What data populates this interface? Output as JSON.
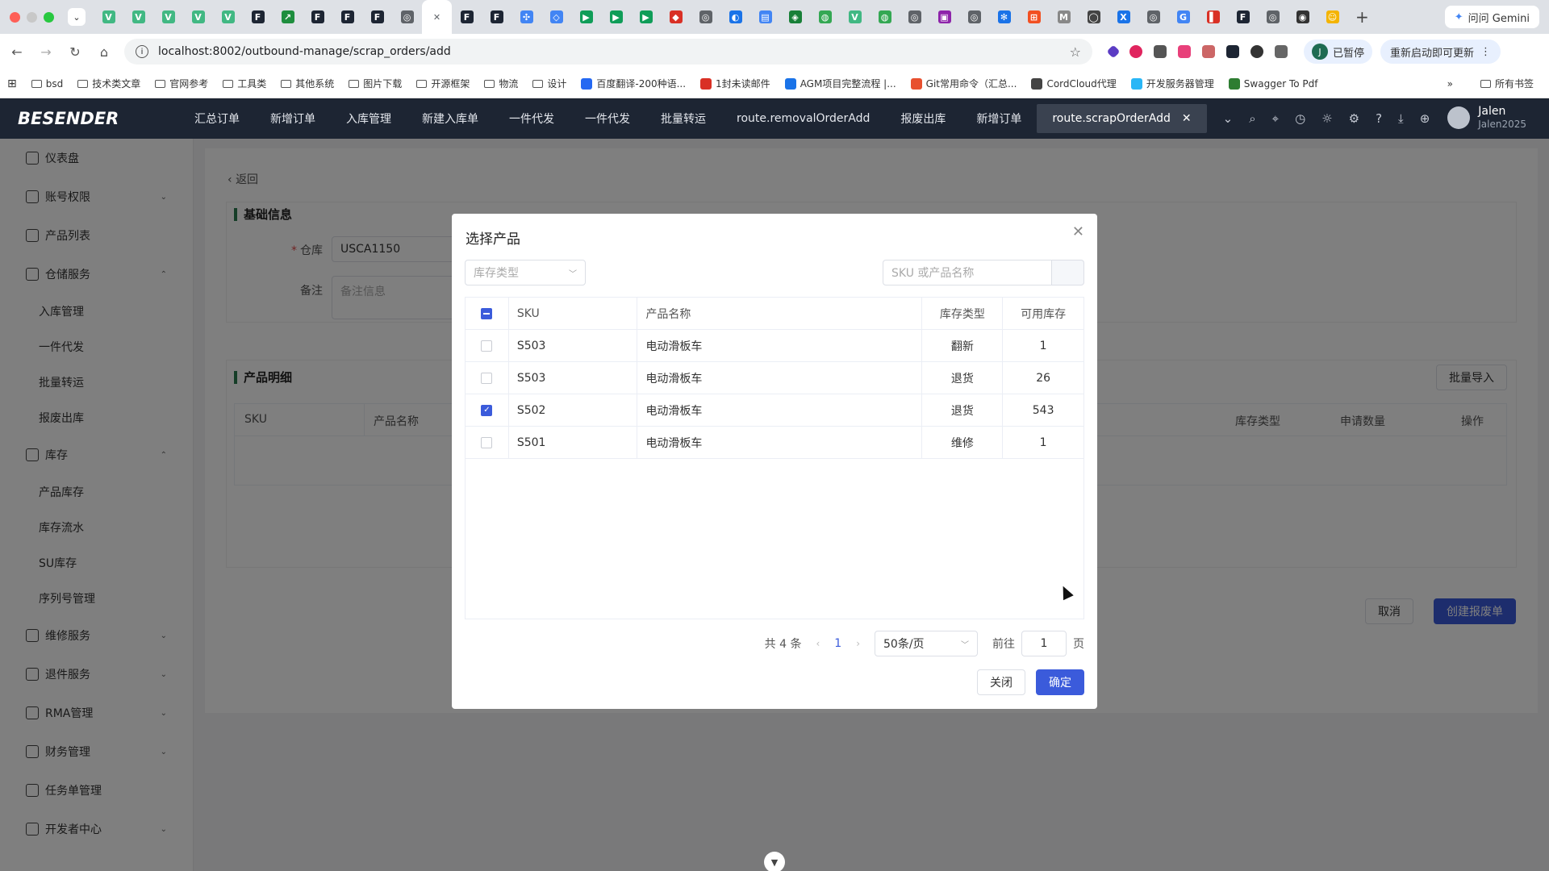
{
  "browser": {
    "gemini_label": "问问 Gemini",
    "url": "localhost:8002/outbound-manage/scrap_orders/add",
    "profile_initial": "J",
    "profile_status": "已暂停",
    "restart_label": "重新启动即可更新",
    "tab_icons": [
      {
        "name": "vue-tab-icon",
        "glyph": "V",
        "color": "#41b883"
      },
      {
        "name": "vue-tab-icon",
        "glyph": "V",
        "color": "#41b883"
      },
      {
        "name": "vue-tab-icon",
        "glyph": "V",
        "color": "#41b883"
      },
      {
        "name": "vue-tab-icon",
        "glyph": "V",
        "color": "#41b883"
      },
      {
        "name": "vue-tab-icon",
        "glyph": "V",
        "color": "#41b883"
      },
      {
        "name": "besender-tab-icon",
        "glyph": "F",
        "color": "#1d2533"
      },
      {
        "name": "chart-tab-icon",
        "glyph": "↗",
        "color": "#1e8e3e"
      },
      {
        "name": "besender-tab-icon",
        "glyph": "F",
        "color": "#1d2533"
      },
      {
        "name": "besender-tab-icon",
        "glyph": "F",
        "color": "#1d2533"
      },
      {
        "name": "besender-tab-icon",
        "glyph": "F",
        "color": "#1d2533"
      },
      {
        "name": "globe-tab-icon",
        "glyph": "◎",
        "color": "#5f6368"
      },
      {
        "name": "close-tab-icon",
        "glyph": "✕",
        "color": "#5f6368"
      },
      {
        "name": "besender-tab-icon",
        "glyph": "F",
        "color": "#1d2533"
      },
      {
        "name": "besender-tab-icon",
        "glyph": "F",
        "color": "#1d2533"
      },
      {
        "name": "network-tab-icon",
        "glyph": "✣",
        "color": "#4285f4"
      },
      {
        "name": "cube-tab-icon",
        "glyph": "◇",
        "color": "#4285f4"
      },
      {
        "name": "play-tab-icon",
        "glyph": "▶",
        "color": "#0f9d58"
      },
      {
        "name": "play-tab-icon",
        "glyph": "▶",
        "color": "#0f9d58"
      },
      {
        "name": "play-tab-icon",
        "glyph": "▶",
        "color": "#0f9d58"
      },
      {
        "name": "red-tab-icon",
        "glyph": "◆",
        "color": "#d93025"
      },
      {
        "name": "globe-tab-icon",
        "glyph": "◎",
        "color": "#5f6368"
      },
      {
        "name": "edge-tab-icon",
        "glyph": "◐",
        "color": "#1a73e8"
      },
      {
        "name": "doc-tab-icon",
        "glyph": "▤",
        "color": "#4285f4"
      },
      {
        "name": "shield-tab-icon",
        "glyph": "◈",
        "color": "#188038"
      },
      {
        "name": "leaf-tab-icon",
        "glyph": "◍",
        "color": "#34a853"
      },
      {
        "name": "vue-tab-icon",
        "glyph": "V",
        "color": "#41b883"
      },
      {
        "name": "leaf-tab-icon",
        "glyph": "◍",
        "color": "#34a853"
      },
      {
        "name": "globe-tab-icon",
        "glyph": "◎",
        "color": "#5f6368"
      },
      {
        "name": "purple-tab-icon",
        "glyph": "▣",
        "color": "#8e24aa"
      },
      {
        "name": "globe-tab-icon",
        "glyph": "◎",
        "color": "#5f6368"
      },
      {
        "name": "gear-tab-icon",
        "glyph": "✻",
        "color": "#1a73e8"
      },
      {
        "name": "microsoft-tab-icon",
        "glyph": "⊞",
        "color": "#f25022"
      },
      {
        "name": "mail-tab-icon",
        "glyph": "M",
        "color": "#888888"
      },
      {
        "name": "node-tab-icon",
        "glyph": "◯",
        "color": "#444444"
      },
      {
        "name": "x-tab-icon",
        "glyph": "X",
        "color": "#1a73e8"
      },
      {
        "name": "globe-tab-icon",
        "glyph": "◎",
        "color": "#5f6368"
      },
      {
        "name": "google-tab-icon",
        "glyph": "G",
        "color": "#4285f4"
      },
      {
        "name": "bookmark-tab-icon",
        "glyph": "▌",
        "color": "#d93025"
      },
      {
        "name": "besender-tab-icon",
        "glyph": "F",
        "color": "#1d2533"
      },
      {
        "name": "globe-tab-icon",
        "glyph": "◎",
        "color": "#5f6368"
      },
      {
        "name": "github-tab-icon",
        "glyph": "◉",
        "color": "#333333"
      },
      {
        "name": "emoji-tab-icon",
        "glyph": "☺",
        "color": "#f4b400"
      }
    ],
    "bookmarks": [
      {
        "label": "bsd",
        "icon": "folder-icon"
      },
      {
        "label": "技术类文章",
        "icon": "folder-icon"
      },
      {
        "label": "官网参考",
        "icon": "folder-icon"
      },
      {
        "label": "工具类",
        "icon": "folder-icon"
      },
      {
        "label": "其他系统",
        "icon": "folder-icon"
      },
      {
        "label": "图片下载",
        "icon": "folder-icon"
      },
      {
        "label": "开源框架",
        "icon": "folder-icon"
      },
      {
        "label": "物流",
        "icon": "folder-icon"
      },
      {
        "label": "设计",
        "icon": "folder-icon"
      },
      {
        "label": "百度翻译-200种语...",
        "icon": "translate-icon",
        "color": "#2468f2"
      },
      {
        "label": "1封未读邮件",
        "icon": "gmail-icon",
        "color": "#d93025"
      },
      {
        "label": "AGM项目完整流程 |...",
        "icon": "onenote-icon",
        "color": "#1a73e8"
      },
      {
        "label": "Git常用命令（汇总...",
        "icon": "csdn-icon",
        "color": "#e8502f"
      },
      {
        "label": "CordCloud代理",
        "icon": "cord-icon",
        "color": "#444444"
      },
      {
        "label": "开发服务器管理",
        "icon": "server-icon",
        "color": "#29b6f6"
      },
      {
        "label": "Swagger To Pdf",
        "icon": "swagger-icon",
        "color": "#2e7d32"
      }
    ],
    "all_bookmarks_label": "所有书签"
  },
  "app": {
    "logo": "BESENDER",
    "nav_tabs": [
      "汇总订单",
      "新增订单",
      "入库管理",
      "新建入库单",
      "一件代发",
      "一件代发",
      "批量转运",
      "route.removalOrderAdd",
      "报废出库",
      "新增订单"
    ],
    "active_tab": "route.scrapOrderAdd",
    "user_name": "Jalen",
    "user_account": "Jalen2025"
  },
  "sidebar": {
    "items": [
      {
        "label": "仪表盘",
        "icon": "home-icon",
        "arrow": ""
      },
      {
        "label": "账号权限",
        "icon": "user-key-icon",
        "arrow": "⌄"
      },
      {
        "label": "产品列表",
        "icon": "list-icon",
        "arrow": ""
      },
      {
        "label": "仓储服务",
        "icon": "warehouse-icon",
        "arrow": "⌃"
      },
      {
        "label": "库存",
        "icon": "inventory-icon",
        "arrow": "⌃"
      },
      {
        "label": "维修服务",
        "icon": "wrench-icon",
        "arrow": "⌄"
      },
      {
        "label": "退件服务",
        "icon": "return-icon",
        "arrow": "⌄"
      },
      {
        "label": "RMA管理",
        "icon": "lock-icon",
        "arrow": "⌄"
      },
      {
        "label": "财务管理",
        "icon": "cart-icon",
        "arrow": "⌄"
      },
      {
        "label": "任务单管理",
        "icon": "task-icon",
        "arrow": ""
      },
      {
        "label": "开发者中心",
        "icon": "api-icon",
        "arrow": "⌄"
      }
    ],
    "warehouse_sub": [
      "入库管理",
      "一件代发",
      "批量转运",
      "报废出库"
    ],
    "inventory_sub": [
      "产品库存",
      "库存流水",
      "SU库存",
      "序列号管理"
    ]
  },
  "page": {
    "back_label": "返回",
    "basic_info_title": "基础信息",
    "warehouse_label": "仓库",
    "warehouse_value": "USCA1150",
    "remark_label": "备注",
    "remark_placeholder": "备注信息",
    "detail_title": "产品明细",
    "batch_import_label": "批量导入",
    "detail_columns": [
      "SKU",
      "产品名称",
      "库存类型",
      "申请数量",
      "操作"
    ],
    "cancel_label": "取消",
    "create_label": "创建报废单"
  },
  "dialog": {
    "title": "选择产品",
    "stock_type_placeholder": "库存类型",
    "search_placeholder": "SKU 或产品名称",
    "columns": [
      "SKU",
      "产品名称",
      "库存类型",
      "可用库存"
    ],
    "rows": [
      {
        "sku": "S503",
        "name": "电动滑板车",
        "type": "翻新",
        "qty": "1",
        "checked": false
      },
      {
        "sku": "S503",
        "name": "电动滑板车",
        "type": "退货",
        "qty": "26",
        "checked": false
      },
      {
        "sku": "S502",
        "name": "电动滑板车",
        "type": "退货",
        "qty": "543",
        "checked": true
      },
      {
        "sku": "S501",
        "name": "电动滑板车",
        "type": "维修",
        "qty": "1",
        "checked": false
      }
    ],
    "total_label": "共 4 条",
    "current_page": "1",
    "page_size": "50条/页",
    "goto_label": "前往",
    "goto_value": "1",
    "page_unit": "页",
    "close_label": "关闭",
    "confirm_label": "确定"
  }
}
